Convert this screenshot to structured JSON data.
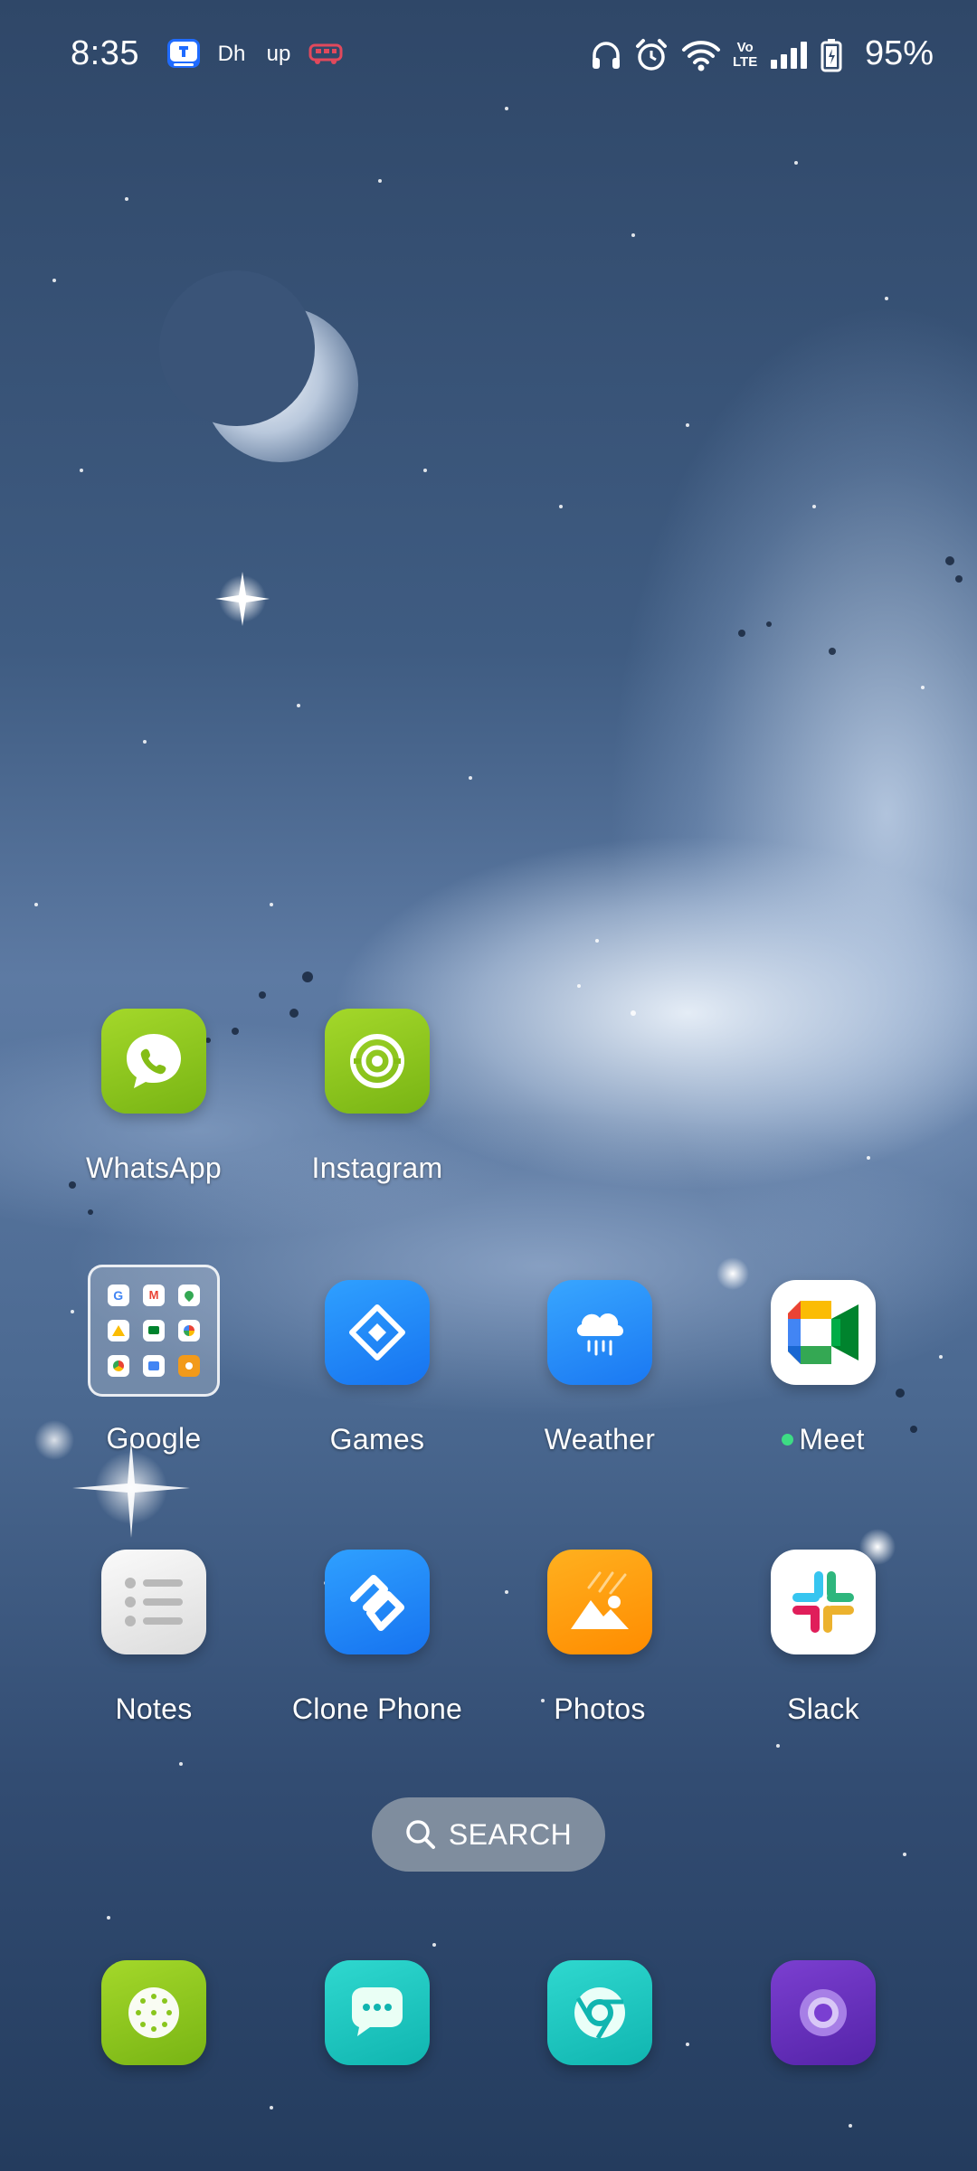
{
  "status_bar": {
    "time": "8:35",
    "battery_percent": "95%",
    "notification_icons": [
      "truecaller-icon",
      "dh-icon",
      "up-icon",
      "bus-icon"
    ],
    "notification_labels": {
      "dh": "Dh",
      "up": "up"
    },
    "system_icons": [
      "headphones-icon",
      "alarm-icon",
      "wifi-icon",
      "volte-icon",
      "signal-icon",
      "battery-icon"
    ],
    "volte_text": [
      "Vo",
      "LTE"
    ]
  },
  "home": {
    "row1": [
      {
        "label": "WhatsApp",
        "icon": "whatsapp-icon"
      },
      {
        "label": "Instagram",
        "icon": "instagram-icon"
      }
    ],
    "row2": [
      {
        "label": "Google",
        "icon": "google-folder-icon"
      },
      {
        "label": "Games",
        "icon": "games-icon"
      },
      {
        "label": "Weather",
        "icon": "weather-icon"
      },
      {
        "label": "Meet",
        "icon": "meet-icon",
        "new_dot": true
      }
    ],
    "row3": [
      {
        "label": "Notes",
        "icon": "notes-icon"
      },
      {
        "label": "Clone Phone",
        "icon": "clone-phone-icon"
      },
      {
        "label": "Photos",
        "icon": "photos-icon"
      },
      {
        "label": "Slack",
        "icon": "slack-icon"
      }
    ]
  },
  "search": {
    "label": "SEARCH",
    "icon": "search-icon"
  },
  "dock": [
    {
      "icon": "phone-dialer-icon"
    },
    {
      "icon": "messages-icon"
    },
    {
      "icon": "browser-icon"
    },
    {
      "icon": "camera-icon"
    }
  ],
  "colors": {
    "accent_green": "#8ac61e",
    "accent_blue": "#1f8cff",
    "new_dot": "#3ddc84",
    "photos_orange": "#ff9a0a",
    "camera_purple": "#6a32b8"
  }
}
